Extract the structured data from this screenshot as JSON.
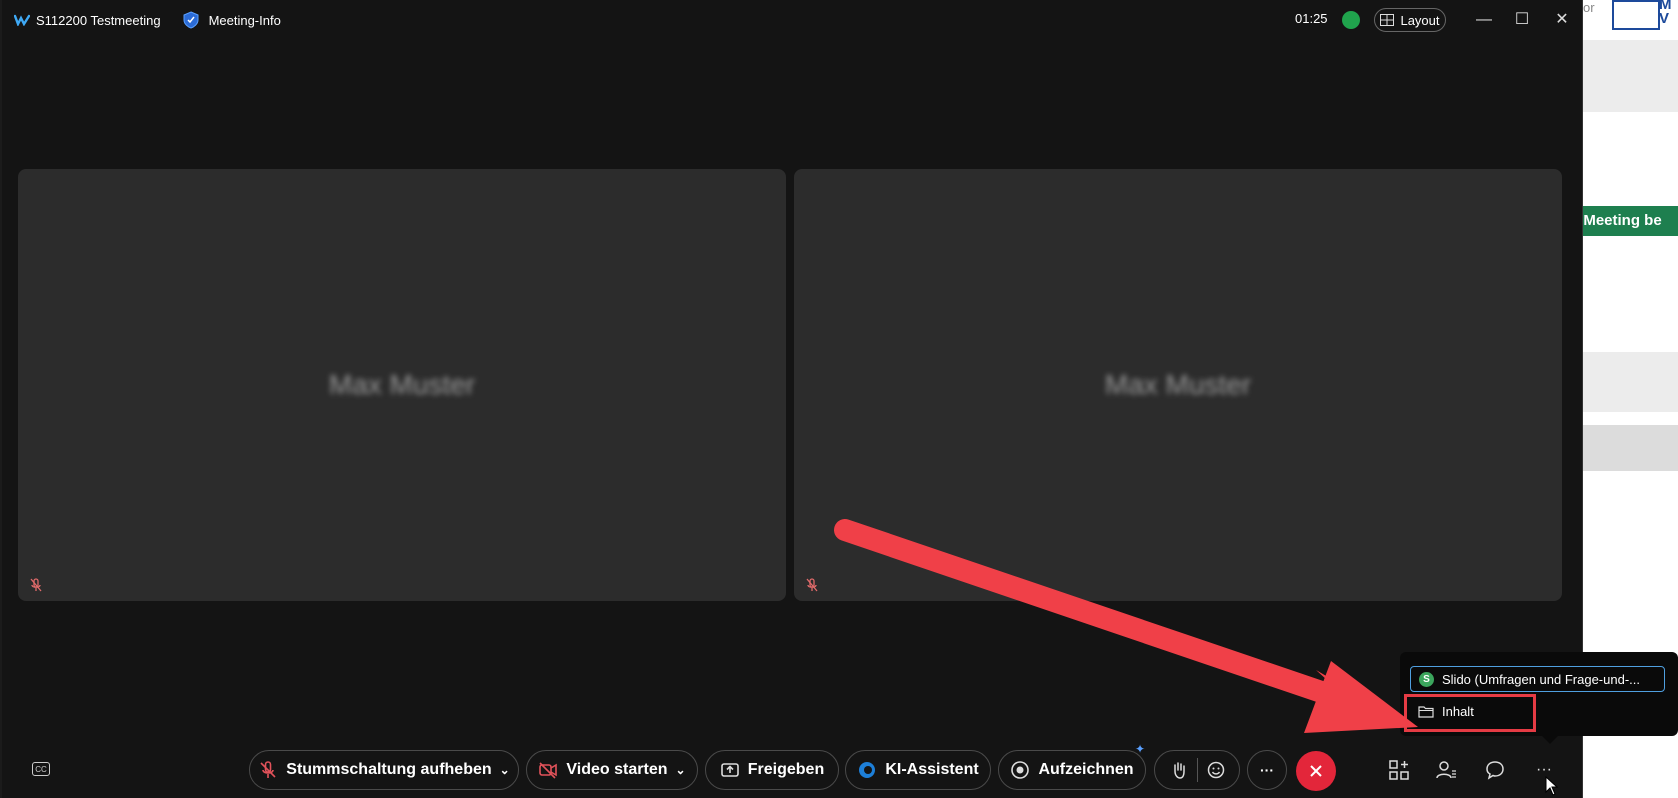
{
  "window": {
    "meeting_title": "S112200 Testmeeting",
    "meeting_info_label": "Meeting-Info",
    "timer": "01:25",
    "layout_label": "Layout"
  },
  "participants": [
    {
      "name": "Max Muster"
    },
    {
      "name": "Max Muster"
    }
  ],
  "toolbar": {
    "unmute_label": "Stummschaltung aufheben",
    "video_label": "Video starten",
    "share_label": "Freigeben",
    "ai_label": "KI-Assistent",
    "record_label": "Aufzeichnen"
  },
  "more_menu": {
    "items": [
      {
        "label": "Slido (Umfragen und Frage-und-..."
      },
      {
        "label": "Inhalt"
      }
    ]
  },
  "background_app": {
    "partial_text": "n Meeting be",
    "or_text": "or",
    "logo_text": "M\nV",
    "accent_color": "#1e7f4f"
  },
  "colors": {
    "end_call": "#e3263a",
    "highlight": "#e53b44",
    "arrow": "#f04048",
    "slido_focus": "#4f9fe0"
  }
}
